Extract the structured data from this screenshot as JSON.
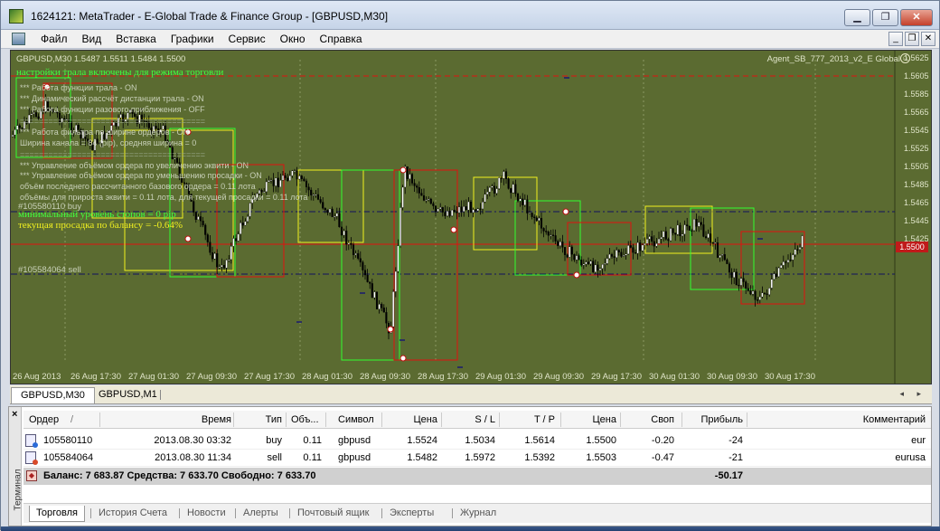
{
  "window": {
    "title": "1624121: MetaTrader - E-Global Trade & Finance Group - [GBPUSD,M30]",
    "minimize_glyph": "▁",
    "maximize_glyph": "❐",
    "close_glyph": "✕"
  },
  "menu": {
    "items": [
      "Файл",
      "Вид",
      "Вставка",
      "Графики",
      "Сервис",
      "Окно",
      "Справка"
    ],
    "mdi_minimize": "_",
    "mdi_restore": "❐",
    "mdi_close": "✕"
  },
  "chart": {
    "symbol_line": "GBPUSD,M30  1.5487 1.5511 1.5484 1.5500",
    "ea_name": "Agent_SB_777_2013_v2_E Global",
    "smile_glyph": "☺",
    "overlay": {
      "headline": "настройки трала включены для режима  торговли",
      "lines": [
        "*** Работа функции трала -   ON",
        "*** Динамический рассчёт дистанции трала -   ON",
        "*** Работа функции разового приближения -   OFF",
        "=======================================",
        "*** Работа фильтра по ширине ордеров -   ON",
        "Ширина канала = 84 (pip), средняя ширина =  0",
        "=======================================",
        "*** Управление объёмом ордера по увеличению эквити -   ON",
        "*** Управление объёмом ордера по уменьшению просадки -   ON",
        "объём последнего рассчитанного базового ордера =   0.11 лота",
        "объёмы для прироста эквити = 0.11 лота, для текущей просадки = 0.11 лота"
      ],
      "buy_label": "#105580110 buy",
      "min_stops": "минимальный уровень стопов =   0 pip",
      "drawdown": "текущая просадка по балансу = -0.64%",
      "sell_label": "#105584064 sell"
    },
    "price_ticks": [
      "1.5625",
      "1.5605",
      "1.5585",
      "1.5565",
      "1.5545",
      "1.5525",
      "1.5505",
      "1.5485",
      "1.5465",
      "1.5445",
      "1.5425"
    ],
    "current_price": "1.5500",
    "time_ticks": [
      "26 Aug 2013",
      "26 Aug 17:30",
      "27 Aug 01:30",
      "27 Aug 09:30",
      "27 Aug 17:30",
      "28 Aug 01:30",
      "28 Aug 09:30",
      "28 Aug 17:30",
      "29 Aug 01:30",
      "29 Aug 09:30",
      "29 Aug 17:30",
      "30 Aug 01:30",
      "30 Aug 09:30",
      "30 Aug 17:30"
    ],
    "colors": {
      "background": "#5b6b31",
      "bull": "#ffffff",
      "bear": "#000000",
      "headline": "#40ff40",
      "info_text": "#c8d0b8",
      "box_red": "#e01010",
      "box_green": "#30ff30",
      "box_yellow": "#f0f020"
    }
  },
  "chart_tabs": {
    "tabs": [
      "GBPUSD,M30",
      "GBPUSD,M1"
    ],
    "arrows": "◂ ▸"
  },
  "terminal": {
    "side_label": "Терминал",
    "close_glyph": "×",
    "columns": [
      "Ордер",
      "/",
      "Время",
      "Тип",
      "Объ...",
      "Символ",
      "Цена",
      "S / L",
      "T / P",
      "Цена",
      "Своп",
      "Прибыль",
      "Комментарий"
    ],
    "rows": [
      {
        "order": "105580110",
        "time": "2013.08.30 03:32",
        "type": "buy",
        "volume": "0.11",
        "symbol": "gbpusd",
        "price": "1.5524",
        "sl": "1.5034",
        "tp": "1.5614",
        "cur_price": "1.5500",
        "swap": "-0.20",
        "profit": "-24",
        "comment": "eur"
      },
      {
        "order": "105584064",
        "time": "2013.08.30 11:34",
        "type": "sell",
        "volume": "0.11",
        "symbol": "gbpusd",
        "price": "1.5482",
        "sl": "1.5972",
        "tp": "1.5392",
        "cur_price": "1.5503",
        "swap": "-0.47",
        "profit": "-21",
        "comment": "eurusa"
      }
    ],
    "balance_text": "Баланс: 7 683.87  Средства: 7 633.70  Свободно: 7 633.70",
    "balance_profit": "-50.17",
    "tabs": [
      "Торговля",
      "История Счета",
      "Новости",
      "Алерты",
      "Почтовый ящик",
      "Эксперты",
      "Журнал"
    ]
  }
}
